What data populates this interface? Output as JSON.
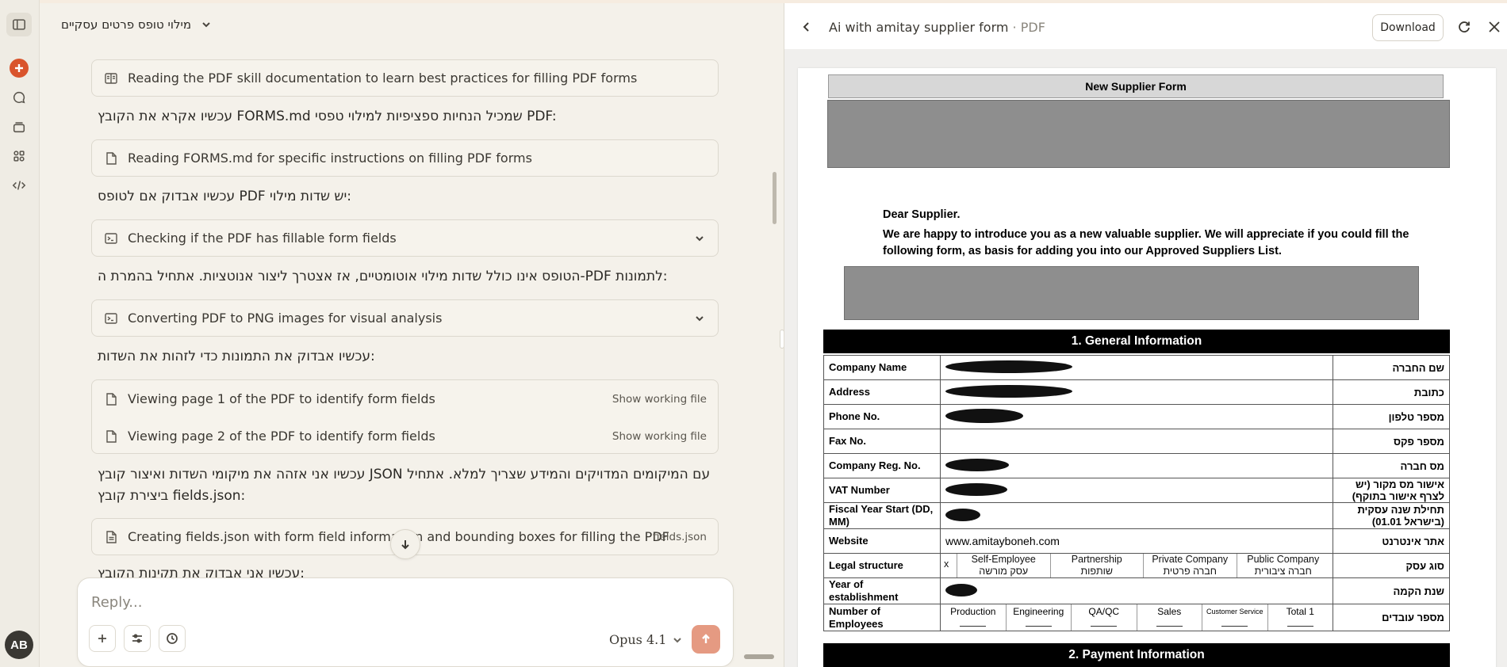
{
  "rail": {
    "user_initials": "AB"
  },
  "chat": {
    "title": "מילוי טופס פרטים עסקיים",
    "steps": [
      {
        "label": "Reading the PDF skill documentation to learn best practices for filling PDF forms"
      },
      {
        "label": "Reading FORMS.md for specific instructions on filling PDF forms"
      },
      {
        "label": "Checking if the PDF has fillable form fields"
      },
      {
        "label": "Converting PDF to PNG images for visual analysis"
      },
      {
        "label": "Viewing page 1 of the PDF to identify form fields",
        "action": "Show working file"
      },
      {
        "label": "Viewing page 2 of the PDF to identify form fields",
        "action": "Show working file"
      },
      {
        "label": "Creating fields.json with form field information and bounding boxes for filling the PDF",
        "file": "fields.json"
      }
    ],
    "paragraphs": [
      "עכשיו אקרא את הקובץ FORMS.md שמכיל הנחיות ספציפיות למילוי טפסי PDF:",
      "עכשיו אבדוק אם לטופס PDF יש שדות מילוי:",
      "הטופס אינו כולל שדות מילוי אוטומטיים, אז אצטרך ליצור אנוטציות. אתחיל בהמרת ה-PDF לתמונות:",
      "עכשיו אבדוק את התמונות כדי לזהות את השדות:",
      "עכשיו אני אזהה את מיקומי השדות ואיצור קובץ JSON עם המיקומים המדויקים והמידע שצריך למלא. אתחיל",
      "ביצירת קובץ fields.json:",
      "עכשיו אני אבדוק את תקינות הקובץ:"
    ],
    "composer_placeholder": "Reply...",
    "model_label": "Opus 4.1",
    "accent": "#d9542c"
  },
  "preview": {
    "title": "Ai with amitay supplier form",
    "type": "PDF",
    "download_label": "Download",
    "doc": {
      "header": "New Supplier Form",
      "greeting": "Dear Supplier.",
      "intro": "We are happy to introduce you as a new valuable supplier. We will appreciate if you could fill the following form, as basis for adding you into our Approved Suppliers List.",
      "section1": "1.   General Information",
      "section2": "2.   Payment Information",
      "rows": [
        {
          "en": "Company Name",
          "he": "שם החברה"
        },
        {
          "en": "Address",
          "he": "כתובת"
        },
        {
          "en": "Phone No.",
          "he": "מספר טלפון"
        },
        {
          "en": "Fax No.",
          "he": "מספר פקס"
        },
        {
          "en": "Company Reg. No.",
          "he": "מס חברה"
        },
        {
          "en": "VAT Number",
          "he": "אישור מס מקור (יש לצרף אישור בתוקף)"
        },
        {
          "en": "Fiscal Year Start (DD, MM)",
          "he": "תחילת שנה עסקית (בישראל 01.01)"
        },
        {
          "en": "Website",
          "he": "אתר אינטרנט",
          "value": "www.amitayboneh.com"
        },
        {
          "en": "Legal structure",
          "he": "סוג עסק"
        },
        {
          "en": "Year of establishment",
          "he": "שנת הקמה"
        },
        {
          "en": "Number of Employees",
          "he": "מספר עובדים"
        }
      ],
      "legal_mark": "x",
      "legal_options": [
        {
          "en": "Self-Employee",
          "he": "עסק מורשה"
        },
        {
          "en": "Partnership",
          "he": "שותפות"
        },
        {
          "en": "Private Company",
          "he": "חברה פרטית"
        },
        {
          "en": "Public Company",
          "he": "חברה ציבורית"
        }
      ],
      "employee_cols": [
        "Production",
        "Engineering",
        "QA/QC",
        "Sales",
        "Customer Service",
        "Total 1"
      ]
    }
  }
}
